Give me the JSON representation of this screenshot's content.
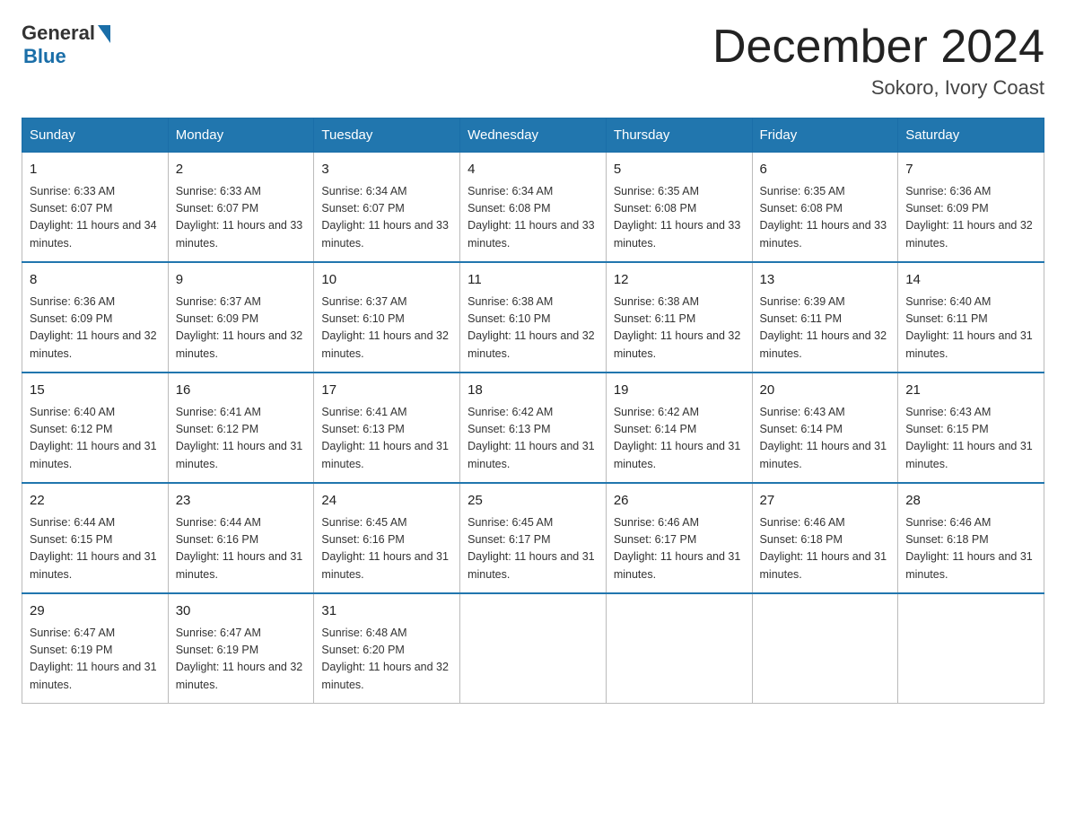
{
  "header": {
    "logo_general": "General",
    "logo_blue": "Blue",
    "month_title": "December 2024",
    "location": "Sokoro, Ivory Coast"
  },
  "weekdays": [
    "Sunday",
    "Monday",
    "Tuesday",
    "Wednesday",
    "Thursday",
    "Friday",
    "Saturday"
  ],
  "weeks": [
    [
      {
        "day": "1",
        "sunrise": "6:33 AM",
        "sunset": "6:07 PM",
        "daylight": "11 hours and 34 minutes."
      },
      {
        "day": "2",
        "sunrise": "6:33 AM",
        "sunset": "6:07 PM",
        "daylight": "11 hours and 33 minutes."
      },
      {
        "day": "3",
        "sunrise": "6:34 AM",
        "sunset": "6:07 PM",
        "daylight": "11 hours and 33 minutes."
      },
      {
        "day": "4",
        "sunrise": "6:34 AM",
        "sunset": "6:08 PM",
        "daylight": "11 hours and 33 minutes."
      },
      {
        "day": "5",
        "sunrise": "6:35 AM",
        "sunset": "6:08 PM",
        "daylight": "11 hours and 33 minutes."
      },
      {
        "day": "6",
        "sunrise": "6:35 AM",
        "sunset": "6:08 PM",
        "daylight": "11 hours and 33 minutes."
      },
      {
        "day": "7",
        "sunrise": "6:36 AM",
        "sunset": "6:09 PM",
        "daylight": "11 hours and 32 minutes."
      }
    ],
    [
      {
        "day": "8",
        "sunrise": "6:36 AM",
        "sunset": "6:09 PM",
        "daylight": "11 hours and 32 minutes."
      },
      {
        "day": "9",
        "sunrise": "6:37 AM",
        "sunset": "6:09 PM",
        "daylight": "11 hours and 32 minutes."
      },
      {
        "day": "10",
        "sunrise": "6:37 AM",
        "sunset": "6:10 PM",
        "daylight": "11 hours and 32 minutes."
      },
      {
        "day": "11",
        "sunrise": "6:38 AM",
        "sunset": "6:10 PM",
        "daylight": "11 hours and 32 minutes."
      },
      {
        "day": "12",
        "sunrise": "6:38 AM",
        "sunset": "6:11 PM",
        "daylight": "11 hours and 32 minutes."
      },
      {
        "day": "13",
        "sunrise": "6:39 AM",
        "sunset": "6:11 PM",
        "daylight": "11 hours and 32 minutes."
      },
      {
        "day": "14",
        "sunrise": "6:40 AM",
        "sunset": "6:11 PM",
        "daylight": "11 hours and 31 minutes."
      }
    ],
    [
      {
        "day": "15",
        "sunrise": "6:40 AM",
        "sunset": "6:12 PM",
        "daylight": "11 hours and 31 minutes."
      },
      {
        "day": "16",
        "sunrise": "6:41 AM",
        "sunset": "6:12 PM",
        "daylight": "11 hours and 31 minutes."
      },
      {
        "day": "17",
        "sunrise": "6:41 AM",
        "sunset": "6:13 PM",
        "daylight": "11 hours and 31 minutes."
      },
      {
        "day": "18",
        "sunrise": "6:42 AM",
        "sunset": "6:13 PM",
        "daylight": "11 hours and 31 minutes."
      },
      {
        "day": "19",
        "sunrise": "6:42 AM",
        "sunset": "6:14 PM",
        "daylight": "11 hours and 31 minutes."
      },
      {
        "day": "20",
        "sunrise": "6:43 AM",
        "sunset": "6:14 PM",
        "daylight": "11 hours and 31 minutes."
      },
      {
        "day": "21",
        "sunrise": "6:43 AM",
        "sunset": "6:15 PM",
        "daylight": "11 hours and 31 minutes."
      }
    ],
    [
      {
        "day": "22",
        "sunrise": "6:44 AM",
        "sunset": "6:15 PM",
        "daylight": "11 hours and 31 minutes."
      },
      {
        "day": "23",
        "sunrise": "6:44 AM",
        "sunset": "6:16 PM",
        "daylight": "11 hours and 31 minutes."
      },
      {
        "day": "24",
        "sunrise": "6:45 AM",
        "sunset": "6:16 PM",
        "daylight": "11 hours and 31 minutes."
      },
      {
        "day": "25",
        "sunrise": "6:45 AM",
        "sunset": "6:17 PM",
        "daylight": "11 hours and 31 minutes."
      },
      {
        "day": "26",
        "sunrise": "6:46 AM",
        "sunset": "6:17 PM",
        "daylight": "11 hours and 31 minutes."
      },
      {
        "day": "27",
        "sunrise": "6:46 AM",
        "sunset": "6:18 PM",
        "daylight": "11 hours and 31 minutes."
      },
      {
        "day": "28",
        "sunrise": "6:46 AM",
        "sunset": "6:18 PM",
        "daylight": "11 hours and 31 minutes."
      }
    ],
    [
      {
        "day": "29",
        "sunrise": "6:47 AM",
        "sunset": "6:19 PM",
        "daylight": "11 hours and 31 minutes."
      },
      {
        "day": "30",
        "sunrise": "6:47 AM",
        "sunset": "6:19 PM",
        "daylight": "11 hours and 32 minutes."
      },
      {
        "day": "31",
        "sunrise": "6:48 AM",
        "sunset": "6:20 PM",
        "daylight": "11 hours and 32 minutes."
      },
      null,
      null,
      null,
      null
    ]
  ]
}
